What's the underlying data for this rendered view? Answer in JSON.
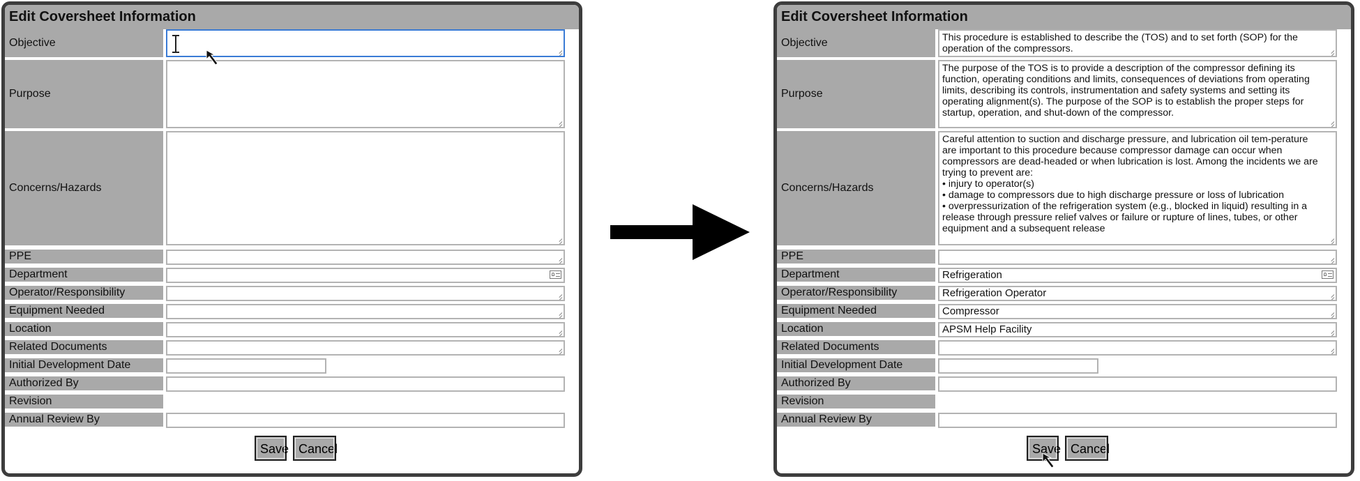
{
  "left_form": {
    "title": "Edit Coversheet Information",
    "fields": [
      {
        "label": "Objective",
        "value": ""
      },
      {
        "label": "Purpose",
        "value": ""
      },
      {
        "label": "Concerns/Hazards",
        "value": ""
      },
      {
        "label": "PPE",
        "value": ""
      },
      {
        "label": "Department",
        "value": ""
      },
      {
        "label": "Operator/Responsibility",
        "value": ""
      },
      {
        "label": "Equipment Needed",
        "value": ""
      },
      {
        "label": "Location",
        "value": ""
      },
      {
        "label": "Related Documents",
        "value": ""
      },
      {
        "label": "Initial Development Date",
        "value": ""
      },
      {
        "label": "Authorized By",
        "value": ""
      },
      {
        "label": "Revision",
        "value": ""
      },
      {
        "label": "Annual Review By",
        "value": ""
      }
    ],
    "save_label": "Save",
    "cancel_label": "Cancel"
  },
  "right_form": {
    "title": "Edit Coversheet Information",
    "fields": [
      {
        "label": "Objective",
        "value": "This procedure is established to describe the (TOS) and to set forth (SOP) for the operation of the compressors."
      },
      {
        "label": "Purpose",
        "value": "The purpose of the TOS is to provide a description of the compressor defining its function, operating conditions and limits, consequences of deviations from operating limits, describing its controls, instrumentation and safety systems and setting its operating alignment(s). The purpose of the SOP is to establish the proper steps for startup, operation, and shut-down of the compressor."
      },
      {
        "label": "Concerns/Hazards",
        "value": "Careful attention to suction and discharge pressure, and lubrication oil tem-perature are important to this procedure because compressor damage can occur when compressors are dead-headed or when lubrication is lost. Among the incidents we are trying to prevent are:\n• injury to operator(s)\n• damage to compressors due to high discharge pressure or loss of lubrication\n• overpressurization of the refrigeration system (e.g., blocked in liquid) resulting in a release through pressure relief valves or failure or rupture of lines, tubes, or other equipment and a subsequent release"
      },
      {
        "label": "PPE",
        "value": ""
      },
      {
        "label": "Department",
        "value": "Refrigeration"
      },
      {
        "label": "Operator/Responsibility",
        "value": "Refrigeration Operator"
      },
      {
        "label": "Equipment Needed",
        "value": "Compressor"
      },
      {
        "label": "Location",
        "value": "APSM Help Facility"
      },
      {
        "label": "Related Documents",
        "value": ""
      },
      {
        "label": "Initial Development Date",
        "value": ""
      },
      {
        "label": "Authorized By",
        "value": ""
      },
      {
        "label": "Revision",
        "value": ""
      },
      {
        "label": "Annual Review By",
        "value": ""
      }
    ],
    "save_label": "Save",
    "cancel_label": "Cancel"
  },
  "icons": {
    "transition": "right-arrow-icon",
    "pointer": "mouse-pointer-icon",
    "text_cursor": "text-cursor-icon",
    "resize": "resize-grip-icon",
    "contact_card": "contact-card-icon"
  }
}
